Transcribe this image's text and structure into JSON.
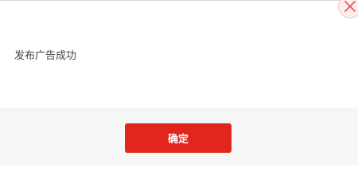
{
  "dialog": {
    "message": "发布广告成功",
    "confirm_label": "确定",
    "close_icon": "close-icon"
  },
  "colors": {
    "accent": "#e1261d",
    "footer_background": "#f6f6f6",
    "close_icon": "#e85a55",
    "close_background": "#fdeeee",
    "message_text": "#444444"
  }
}
